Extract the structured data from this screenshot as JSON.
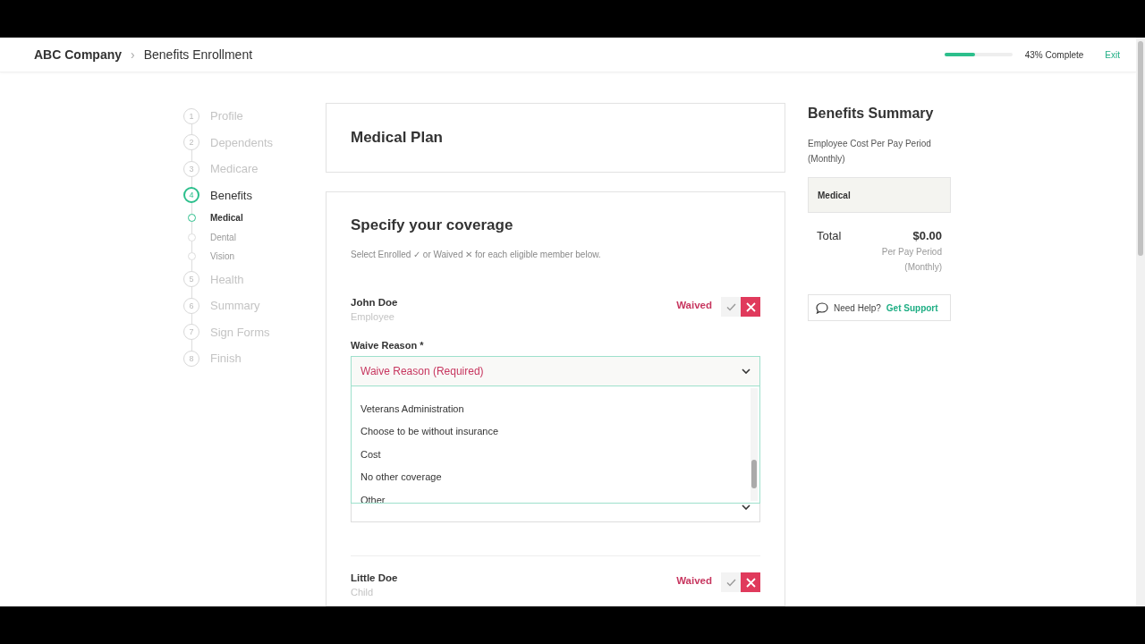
{
  "header": {
    "company": "ABC Company",
    "separator": "›",
    "title": "Benefits Enrollment",
    "progress": {
      "level": 0.45,
      "label": "43% Complete"
    },
    "exit": "Exit"
  },
  "steps": [
    {
      "number": "1",
      "label": "Profile",
      "selected": false
    },
    {
      "number": "2",
      "label": "Dependents",
      "selected": false
    },
    {
      "number": "3",
      "label": "Medicare",
      "selected": false
    },
    {
      "number": "4",
      "label": "Benefits",
      "selected": true,
      "children": [
        {
          "label": "Medical",
          "selected": true
        },
        {
          "label": "Dental",
          "selected": false
        },
        {
          "label": "Vision",
          "selected": false
        }
      ]
    },
    {
      "number": "5",
      "label": "Health",
      "selected": false
    },
    {
      "number": "6",
      "label": "Summary",
      "selected": false
    },
    {
      "number": "7",
      "label": "Sign Forms",
      "selected": false
    },
    {
      "number": "8",
      "label": "Finish",
      "selected": false
    }
  ],
  "plan_card": {
    "title": "Medical Plan"
  },
  "coverage": {
    "title": "Specify your coverage",
    "instructions": "Select Enrolled ✓ or Waived ✕ for each eligible member below.",
    "members": [
      {
        "name": "John Doe",
        "role": "Employee",
        "status": "Waived",
        "waived": true,
        "reason": {
          "label": "Waive Reason *",
          "placeholder": "Waive Reason (Required)"
        },
        "dropdown": {
          "options": [
            "Veterans Administration",
            "Choose to be without insurance",
            "Cost",
            "No other coverage",
            "Other"
          ]
        },
        "second_select": true
      },
      {
        "name": "Little Doe",
        "role": "Child",
        "status": "Waived",
        "waived": true
      }
    ]
  },
  "summary": {
    "title": "Benefits Summary",
    "subtitle": "Employee Cost Per Pay Period (Monthly)",
    "plan": "Medical",
    "total_label": "Total",
    "amount": "$0.00",
    "period": "Per Pay Period (Monthly)",
    "help": "Need Help?",
    "support_link": "Get Support"
  }
}
